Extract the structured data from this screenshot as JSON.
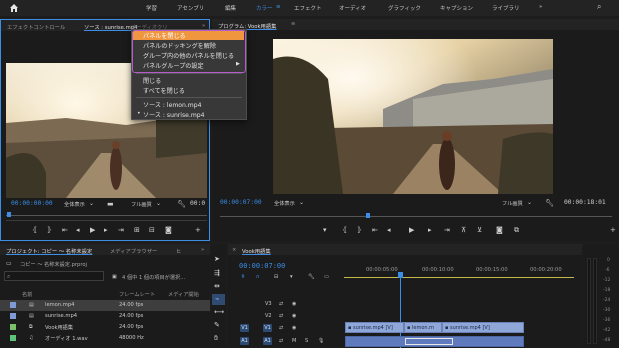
{
  "workspaces": {
    "items": [
      "学習",
      "アセンブリ",
      "編集",
      "カラー",
      "エフェクト",
      "オーディオ",
      "グラフィック",
      "キャプション",
      "ライブラリ"
    ],
    "active_index": 3
  },
  "source_panel": {
    "tabs": [
      "エフェクトコントロール",
      "ソース : sunrise.mp4",
      "オーディオクリ"
    ],
    "timecode": "00:00:00:00",
    "zoom": "全体表示",
    "quality": "フル画質",
    "end_timecode": "00:0"
  },
  "context_menu": {
    "items": [
      "パネルを閉じる",
      "パネルのドッキングを解除",
      "グループ内の他のパネルを閉じる",
      "パネルグループの設定"
    ],
    "items2": [
      "閉じる",
      "すべてを閉じる"
    ],
    "items3": [
      "ソース : lemon.mp4",
      "ソース : sunrise.mp4"
    ],
    "checked": "•",
    "submenu_arrow": "▶"
  },
  "program_panel": {
    "title": "プログラム: Vook用語集",
    "timecode": "00:00:07:00",
    "zoom": "全体表示",
    "quality": "フル画質",
    "duration": "00:00:18:01"
  },
  "project_panel": {
    "tabs": [
      "プロジェクト: コピー ～ 名称未設定",
      "メディアブラウザー",
      "ヒ"
    ],
    "project_file": "コピー ～ 名称未設定.prproj",
    "selection_info": "4 個中 1 個の項目が選択...",
    "columns": [
      "名前",
      "フレームレート",
      "メディア開始"
    ],
    "rows": [
      {
        "name": "lemon.mp4",
        "fps": "24.00 fps",
        "color": "#7f9bd6"
      },
      {
        "name": "sunrise.mp4",
        "fps": "24.00 fps",
        "color": "#7f9bd6"
      },
      {
        "name": "Vook用語集",
        "fps": "24.00 fps",
        "color": "#7bbf6a"
      },
      {
        "name": "オーディオ 1.wav",
        "fps": "48000 Hz",
        "color": "#5ec27a"
      }
    ]
  },
  "timeline": {
    "title": "Vook用語集",
    "timecode": "00:00:07:00",
    "ruler": [
      "00:00:05:00",
      "00:00:10:00",
      "00:00:15:00",
      "00:00:20:00"
    ],
    "tracks": [
      "V3",
      "V2",
      "V1",
      "A1"
    ],
    "clips": [
      "sunrise.mp4 [V]",
      "lemon.m",
      "sunrise.mp4 [V]"
    ],
    "meter_labels": [
      "0",
      "-6",
      "-12",
      "-18",
      "-24",
      "-30",
      "-36",
      "-42",
      "-48"
    ]
  },
  "colors": {
    "accent": "#3a8ee6",
    "menu_highlight": "#f0963f",
    "menu_outline": "#b65bcc",
    "clip_video": "#8fa6d9"
  }
}
